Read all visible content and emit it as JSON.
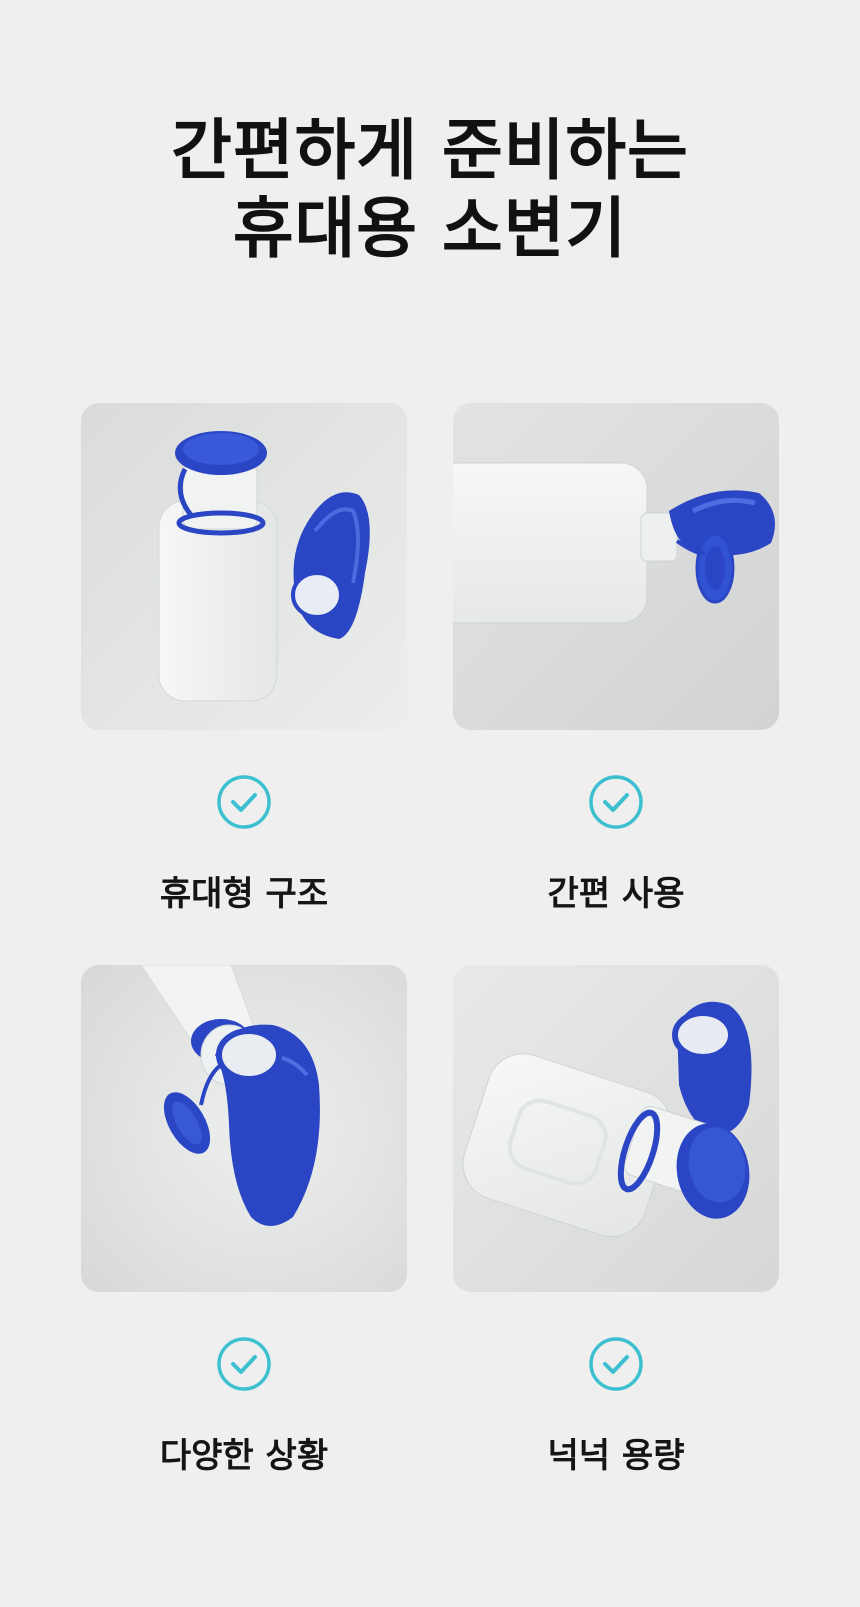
{
  "header": {
    "title_line1": "간편하게 준비하는",
    "title_line2": "휴대용 소변기"
  },
  "features": [
    {
      "label": "휴대형 구조",
      "icon": "check-circle-icon",
      "photo": "urinal-bottle-with-funnel-photo"
    },
    {
      "label": "간편 사용",
      "icon": "check-circle-icon",
      "photo": "urinal-bottle-lying-photo"
    },
    {
      "label": "다양한 상황",
      "icon": "check-circle-icon",
      "photo": "urinal-funnel-closeup-photo"
    },
    {
      "label": "넉넉 용량",
      "icon": "check-circle-icon",
      "photo": "urinal-bottle-with-cap-photo"
    }
  ],
  "colors": {
    "background": "#efefef",
    "accent_check": "#3cbfcf",
    "product_blue": "#2a46c4",
    "text": "#151515"
  }
}
